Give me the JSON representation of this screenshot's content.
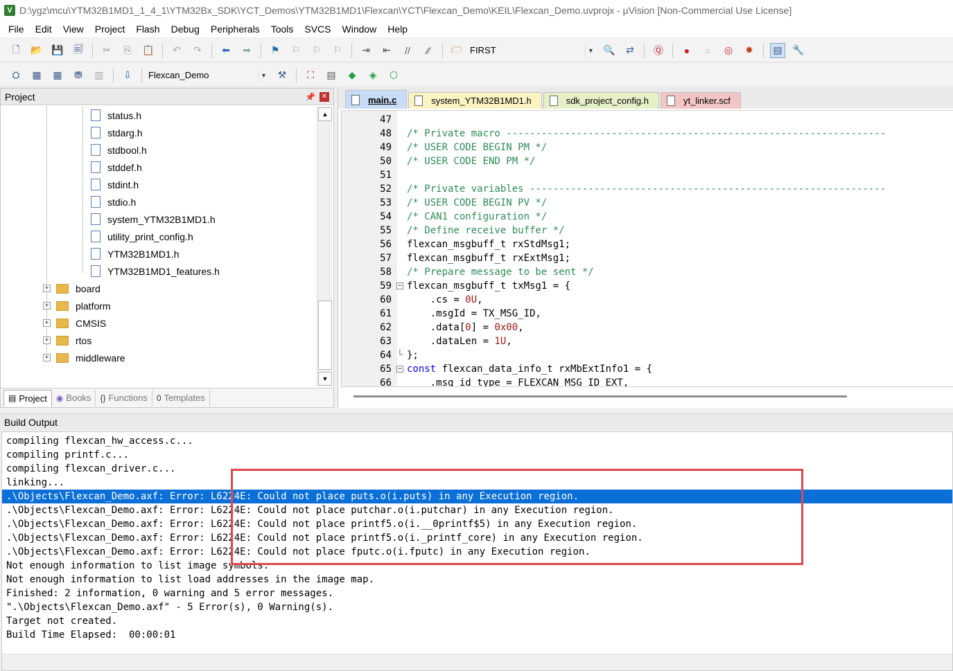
{
  "window": {
    "title": "D:\\ygz\\mcu\\YTM32B1MD1_1_4_1\\YTM32Bx_SDK\\YCT_Demos\\YTM32B1MD1\\Flexcan\\YCT\\Flexcan_Demo\\KEIL\\Flexcan_Demo.uvprojx - µVision  [Non-Commercial Use License]",
    "app_icon_letter": "V"
  },
  "menu": [
    "File",
    "Edit",
    "View",
    "Project",
    "Flash",
    "Debug",
    "Peripherals",
    "Tools",
    "SVCS",
    "Window",
    "Help"
  ],
  "toolbar": {
    "find_value": "FIRST",
    "target_value": "Flexcan_Demo"
  },
  "project_panel": {
    "title": "Project",
    "files": [
      "status.h",
      "stdarg.h",
      "stdbool.h",
      "stddef.h",
      "stdint.h",
      "stdio.h",
      "system_YTM32B1MD1.h",
      "utility_print_config.h",
      "YTM32B1MD1.h",
      "YTM32B1MD1_features.h"
    ],
    "folders": [
      "board",
      "platform",
      "CMSIS",
      "rtos",
      "middleware"
    ],
    "tabs": [
      "Project",
      "Books",
      "Functions",
      "Templates"
    ]
  },
  "editor": {
    "tabs": [
      {
        "label": "main.c",
        "color": "#c8dcf5",
        "active": true
      },
      {
        "label": "system_YTM32B1MD1.h",
        "color": "#fbf3c2",
        "active": false
      },
      {
        "label": "sdk_project_config.h",
        "color": "#e6f0c8",
        "active": false
      },
      {
        "label": "yt_linker.scf",
        "color": "#f3c6c6",
        "active": false
      }
    ],
    "lines": [
      {
        "n": "47",
        "text": ""
      },
      {
        "n": "48",
        "text": "/* Private macro -----------------------------------------------------------------",
        "cls": "cmt"
      },
      {
        "n": "49",
        "text": "/* USER CODE BEGIN PM */",
        "cls": "cmt"
      },
      {
        "n": "50",
        "text": "/* USER CODE END PM */",
        "cls": "cmt"
      },
      {
        "n": "51",
        "text": ""
      },
      {
        "n": "52",
        "text": "/* Private variables -------------------------------------------------------------",
        "cls": "cmt"
      },
      {
        "n": "53",
        "text": "/* USER CODE BEGIN PV */",
        "cls": "cmt"
      },
      {
        "n": "54",
        "text": "/* CAN1 configuration */",
        "cls": "cmt"
      },
      {
        "n": "55",
        "text": "/* Define receive buffer */",
        "cls": "cmt"
      },
      {
        "n": "56",
        "text": "flexcan_msgbuff_t rxStdMsg1;"
      },
      {
        "n": "57",
        "text": "flexcan_msgbuff_t rxExtMsg1;"
      },
      {
        "n": "58",
        "text": "/* Prepare message to be sent */",
        "cls": "cmt"
      },
      {
        "n": "59",
        "text": "flexcan_msgbuff_t txMsg1 = {",
        "fold": "−"
      },
      {
        "n": "60",
        "text": "    .cs = ",
        "num": "0U",
        "tail": ","
      },
      {
        "n": "61",
        "text": "    .msgId = TX_MSG_ID,"
      },
      {
        "n": "62",
        "text": "    .data[",
        "num": "0",
        "tail": "] = ",
        "num2": "0x00",
        "tail2": ","
      },
      {
        "n": "63",
        "text": "    .dataLen = ",
        "num": "1U",
        "tail": ","
      },
      {
        "n": "64",
        "text": "};",
        "fold": "end"
      },
      {
        "n": "65",
        "kw": "const",
        "text": " flexcan_data_info_t rxMbExtInfo1 = {",
        "fold": "−"
      },
      {
        "n": "66",
        "text": "    .msg_id_type = FLEXCAN_MSG_ID_EXT,"
      }
    ]
  },
  "build_output": {
    "title": "Build Output",
    "lines": [
      "compiling flexcan_hw_access.c...",
      "compiling printf.c...",
      "compiling flexcan_driver.c...",
      "linking...",
      ".\\Objects\\Flexcan_Demo.axf: Error: L6224E: Could not place puts.o(i.puts) in any Execution region.",
      ".\\Objects\\Flexcan_Demo.axf: Error: L6224E: Could not place putchar.o(i.putchar) in any Execution region.",
      ".\\Objects\\Flexcan_Demo.axf: Error: L6224E: Could not place printf5.o(i.__0printf$5) in any Execution region.",
      ".\\Objects\\Flexcan_Demo.axf: Error: L6224E: Could not place printf5.o(i._printf_core) in any Execution region.",
      ".\\Objects\\Flexcan_Demo.axf: Error: L6224E: Could not place fputc.o(i.fputc) in any Execution region.",
      "Not enough information to list image symbols.",
      "Not enough information to list load addresses in the image map.",
      "Finished: 2 information, 0 warning and 5 error messages.",
      "\".\\Objects\\Flexcan_Demo.axf\" - 5 Error(s), 0 Warning(s).",
      "Target not created.",
      "Build Time Elapsed:  00:00:01"
    ],
    "selected_index": 4
  },
  "icons": {
    "new": "new-file-icon",
    "open": "open-icon",
    "save": "save-icon",
    "save_all": "save-all-icon",
    "cut": "cut-icon",
    "copy": "copy-icon",
    "paste": "paste-icon",
    "undo": "undo-icon",
    "redo": "redo-icon",
    "back": "back-arrow-icon",
    "forward": "forward-arrow-icon",
    "bookmark": "bookmark-icon"
  }
}
